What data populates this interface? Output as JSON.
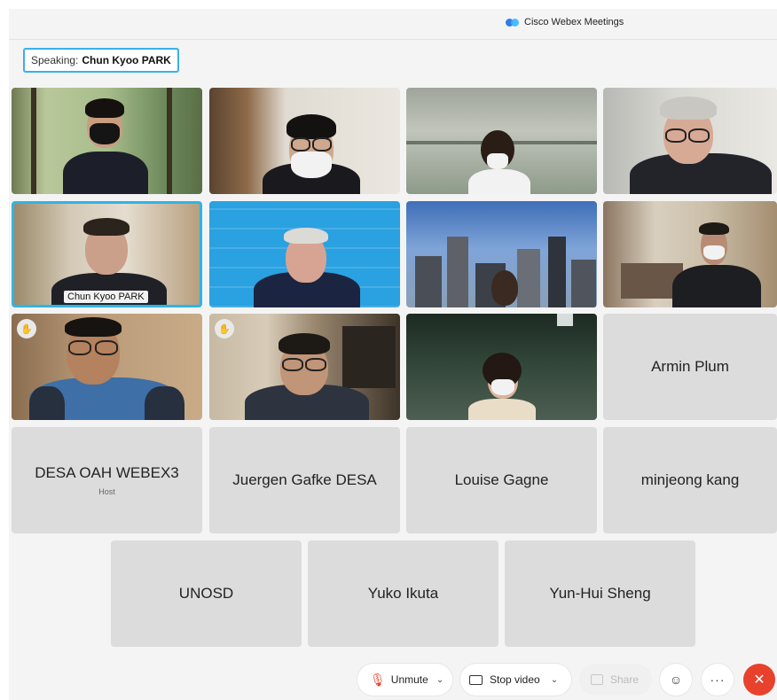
{
  "app": {
    "title": "Cisco Webex Meetings"
  },
  "speaking": {
    "prefix": "Speaking:",
    "name": "Chun Kyoo PARK"
  },
  "video_tiles": [
    {
      "id": "v1"
    },
    {
      "id": "v2"
    },
    {
      "id": "v3"
    },
    {
      "id": "v4"
    },
    {
      "id": "v5",
      "label": "Chun Kyoo PARK"
    },
    {
      "id": "v6"
    },
    {
      "id": "v7"
    },
    {
      "id": "v8"
    },
    {
      "id": "v9",
      "hand": "✋"
    },
    {
      "id": "v10",
      "hand": "✋"
    },
    {
      "id": "v11"
    }
  ],
  "name_tiles": [
    {
      "name": "Armin Plum"
    },
    {
      "name": "DESA OAH WEBEX3",
      "role": "Host"
    },
    {
      "name": "Juergen Gafke DESA"
    },
    {
      "name": "Louise Gagne"
    },
    {
      "name": "minjeong kang"
    },
    {
      "name": "UNOSD"
    },
    {
      "name": "Yuko Ikuta"
    },
    {
      "name": "Yun-Hui Sheng"
    }
  ],
  "toolbar": {
    "unmute_label": "Unmute",
    "stop_video_label": "Stop video",
    "share_label": "Share",
    "colors": {
      "end": "#e8412c",
      "accent": "#2fb4e8"
    }
  }
}
